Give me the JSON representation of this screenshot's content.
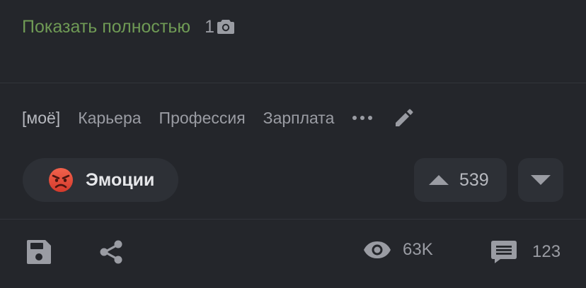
{
  "post": {
    "show_full_label": "Показать полностью",
    "photo_count": "1"
  },
  "tags": {
    "items": [
      "[моё]",
      "Карьера",
      "Профессия",
      "Зарплата"
    ]
  },
  "emotions": {
    "label": "Эмоции"
  },
  "rating": {
    "value": "539"
  },
  "stats": {
    "views": "63K",
    "comments": "123"
  },
  "icons": {
    "photo": "camera-icon",
    "more": "more-dots-icon",
    "edit": "pencil-icon",
    "emotion": "angry-face-icon",
    "vote_up": "triangle-up-icon",
    "vote_down": "triangle-down-icon",
    "save": "floppy-disk-icon",
    "share": "share-icon",
    "views": "eye-icon",
    "comments": "comment-icon"
  },
  "colors": {
    "background": "#24262b",
    "link": "#6f9a55",
    "muted_text": "#9a9ca3",
    "button_bg": "#2d3036",
    "emoji_red": "#e24a3b"
  }
}
